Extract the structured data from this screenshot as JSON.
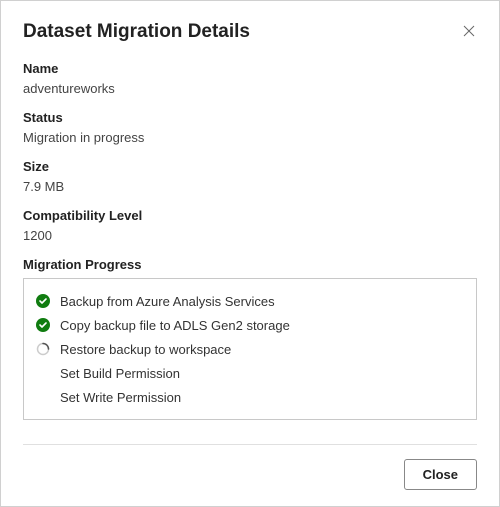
{
  "dialog": {
    "title": "Dataset Migration Details",
    "close_label": "Close"
  },
  "fields": {
    "name": {
      "label": "Name",
      "value": "adventureworks"
    },
    "status": {
      "label": "Status",
      "value": "Migration in progress"
    },
    "size": {
      "label": "Size",
      "value": "7.9 MB"
    },
    "compat": {
      "label": "Compatibility Level",
      "value": "1200"
    }
  },
  "progress": {
    "label": "Migration Progress",
    "steps": [
      {
        "label": "Backup from Azure Analysis Services",
        "state": "done"
      },
      {
        "label": "Copy backup file to ADLS Gen2 storage",
        "state": "done"
      },
      {
        "label": "Restore backup to workspace",
        "state": "in-progress"
      },
      {
        "label": "Set Build Permission",
        "state": "pending"
      },
      {
        "label": "Set Write Permission",
        "state": "pending"
      }
    ]
  },
  "colors": {
    "success": "#107c10",
    "spinner": "#777777"
  }
}
